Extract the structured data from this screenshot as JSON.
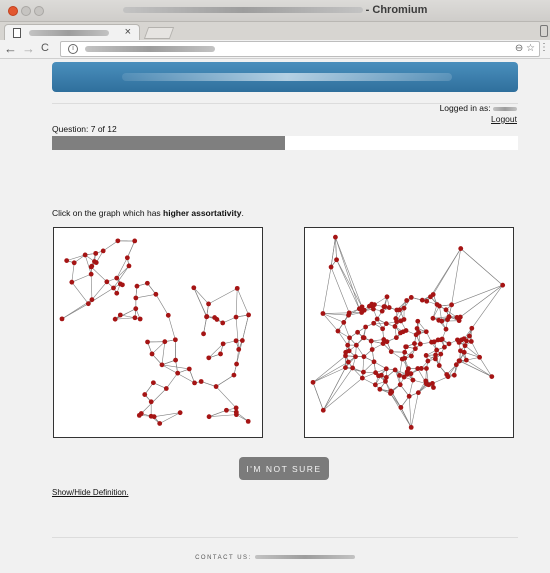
{
  "window": {
    "app_suffix": "- Chromium"
  },
  "tab": {
    "close_glyph": "×"
  },
  "toolbar": {
    "back_glyph": "←",
    "forward_glyph": "→",
    "reload_glyph": "C",
    "info_glyph": "i",
    "zoom_glyph": "⊖",
    "star_glyph": "☆",
    "menu_glyph": "⋮"
  },
  "session": {
    "logged_in_label": "Logged in as:",
    "logout_label": "Logout"
  },
  "quiz": {
    "question_label": "Question: 7 of 12",
    "progress_fraction": 0.5,
    "instruction_prefix": "Click on the graph which has ",
    "instruction_bold": "higher assortativity",
    "instruction_suffix": ".",
    "not_sure_label": "I'M NOT SURE",
    "definition_toggle_label": "Show/Hide Definition."
  },
  "footer": {
    "contact_label": "CONTACT US:"
  },
  "colors": {
    "node": "#a51414",
    "edge": "#808080",
    "banner": "#3a7eaf",
    "progress": "#7f7f7f"
  }
}
